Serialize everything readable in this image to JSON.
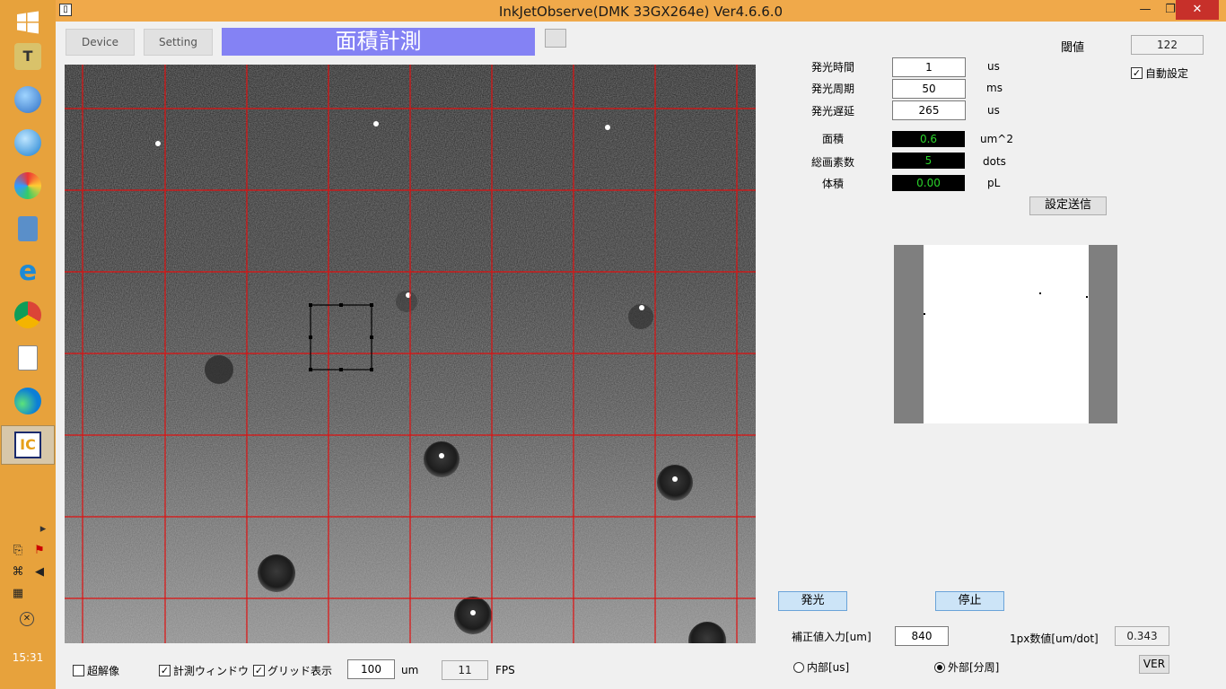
{
  "window": {
    "title": "InkJetObserve(DMK 33GX264e) Ver4.6.6.0",
    "app_icon": "IC"
  },
  "taskbar": {
    "clock": "15:31"
  },
  "top": {
    "device_label": "Device",
    "setting_label": "Setting",
    "mode_title": "面積計測"
  },
  "threshold": {
    "label": "閾値",
    "value": "122",
    "auto_label": "自動設定",
    "auto_checked": true
  },
  "params": [
    {
      "label": "発光時間",
      "value": "1",
      "unit": "us"
    },
    {
      "label": "発光周期",
      "value": "50",
      "unit": "ms"
    },
    {
      "label": "発光遅延",
      "value": "265",
      "unit": "us"
    }
  ],
  "measure": [
    {
      "label": "面積",
      "value": "0.6",
      "unit": "um^2"
    },
    {
      "label": "総画素数",
      "value": "5",
      "unit": "dots"
    },
    {
      "label": "体積",
      "value": "0.00",
      "unit": "pL"
    }
  ],
  "send_button": "設定送信",
  "emit_button": "発光",
  "stop_button": "停止",
  "correction": {
    "label": "補正値入力[um]",
    "value": "840"
  },
  "px_value": {
    "label": "1px数値[um/dot]",
    "value": "0.343"
  },
  "radio_internal": "内部[us]",
  "radio_external": "外部[分周]",
  "ver_button": "VER",
  "bottom": {
    "super_res": "超解像",
    "measure_window": "計測ウィンドウ",
    "grid_display": "グリッド表示",
    "grid_value": "100",
    "grid_unit": "um",
    "fps_value": "11",
    "fps_label": "FPS"
  },
  "colors": {
    "grid": "#e01010",
    "banner": "#8482f4",
    "measure_text": "#2ad32a",
    "taskbar": "#e7a23c",
    "titlebar": "#f0a94a"
  }
}
